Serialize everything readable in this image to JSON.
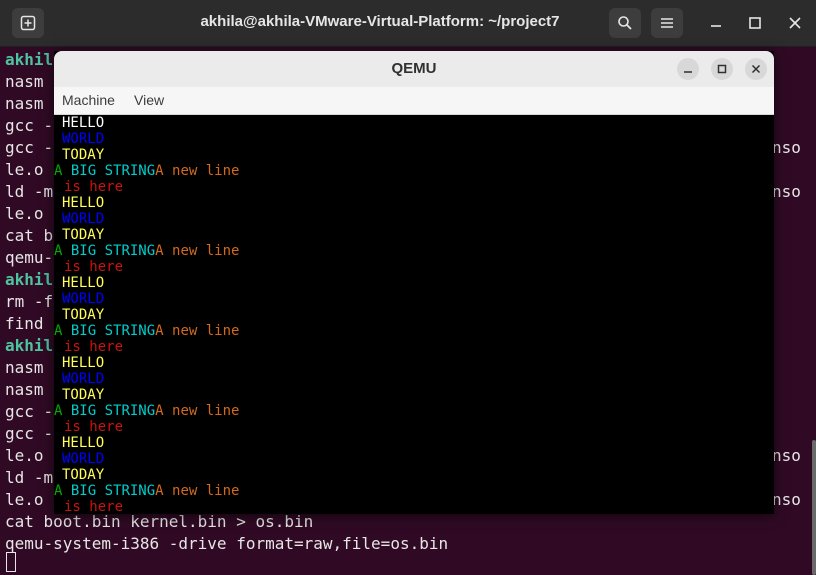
{
  "terminal": {
    "title": "akhila@akhila-VMware-Virtual-Platform: ~/project7",
    "lines": [
      "akhil",
      "nasm ",
      "nasm ",
      "gcc -",
      "gcc -",
      "le.o ",
      "ld -m",
      "le.o ",
      "cat b",
      "qemu-",
      "akhil",
      "rm -f",
      "find ",
      "akhil",
      "nasm ",
      "nasm ",
      "gcc -",
      "gcc -",
      "le.o ",
      "ld -m",
      "le.o ",
      "cat boot.bin kernel.bin > os.bin",
      "qemu-system-i386 -drive format=raw,file=os.bin"
    ],
    "right_fragments": [
      "nso",
      "nso",
      "nso",
      "nso"
    ]
  },
  "qemu": {
    "title": "QEMU",
    "menu": [
      "Machine",
      "View"
    ],
    "screen_lines": [
      {
        "text": "HELLO",
        "color": "#ffffff"
      },
      {
        "text": "WORLD",
        "color": "#0000ff"
      },
      {
        "text": "TODAY",
        "color": "#ffff55"
      },
      {
        "segments": [
          {
            "text": "A BIG STRING",
            "color": "#00cccc"
          },
          {
            "text": "A new line",
            "color": "#d2691e"
          }
        ],
        "lead": "A",
        "leadColor": "#00aa00"
      },
      {
        "text": "is here",
        "color": "#cc1111"
      },
      {
        "text": "HELLO",
        "color": "#ffff55"
      },
      {
        "text": "WORLD",
        "color": "#0000ff"
      },
      {
        "text": "TODAY",
        "color": "#ffff55"
      },
      {
        "segments": [
          {
            "text": "A BIG STRING",
            "color": "#00cccc"
          },
          {
            "text": "A new line",
            "color": "#d2691e"
          }
        ],
        "lead": "A",
        "leadColor": "#00aa00"
      },
      {
        "text": "is here",
        "color": "#cc1111"
      },
      {
        "text": "HELLO",
        "color": "#ffff55"
      },
      {
        "text": "WORLD",
        "color": "#0000ff"
      },
      {
        "text": "TODAY",
        "color": "#ffff55"
      },
      {
        "segments": [
          {
            "text": "A BIG STRING",
            "color": "#00cccc"
          },
          {
            "text": "A new line",
            "color": "#d2691e"
          }
        ],
        "lead": "A",
        "leadColor": "#00aa00"
      },
      {
        "text": "is here",
        "color": "#cc1111"
      },
      {
        "text": "HELLO",
        "color": "#ffff55"
      },
      {
        "text": "WORLD",
        "color": "#0000ff"
      },
      {
        "text": "TODAY",
        "color": "#ffff55"
      },
      {
        "segments": [
          {
            "text": "A BIG STRING",
            "color": "#00cccc"
          },
          {
            "text": "A new line",
            "color": "#d2691e"
          }
        ],
        "lead": "A",
        "leadColor": "#00aa00"
      },
      {
        "text": "is here",
        "color": "#cc1111"
      },
      {
        "text": "HELLO",
        "color": "#ffff55"
      },
      {
        "text": "WORLD",
        "color": "#0000ff"
      },
      {
        "text": "TODAY",
        "color": "#ffff55"
      },
      {
        "segments": [
          {
            "text": "A BIG STRING",
            "color": "#00cccc"
          },
          {
            "text": "A new line",
            "color": "#d2691e"
          }
        ],
        "lead": "A",
        "leadColor": "#00aa00"
      },
      {
        "text": "is here",
        "color": "#cc1111"
      }
    ]
  }
}
